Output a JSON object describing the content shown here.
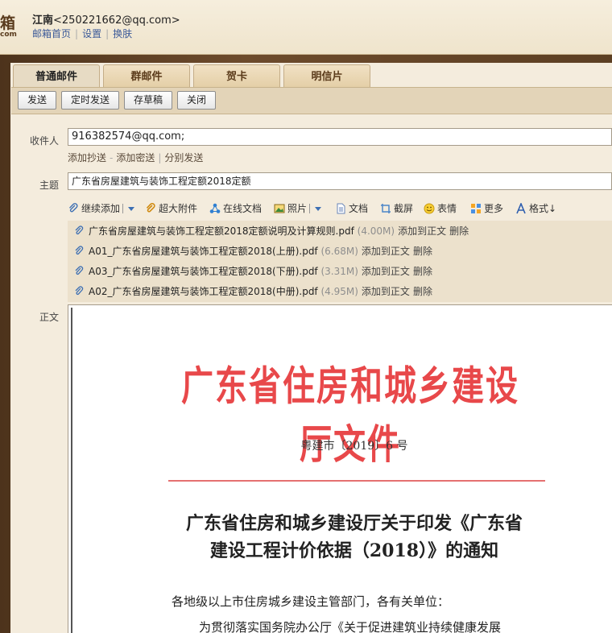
{
  "header": {
    "logo_char": "箱",
    "logo_sub": "com",
    "user_name": "江南",
    "user_email": "<250221662@qq.com>",
    "links": [
      "邮箱首页",
      "设置",
      "换肤"
    ]
  },
  "tabs": [
    "普通邮件",
    "群邮件",
    "贺卡",
    "明信片"
  ],
  "toolbar": {
    "send": "发送",
    "schedule": "定时发送",
    "draft": "存草稿",
    "close": "关闭"
  },
  "compose": {
    "to_label": "收件人",
    "to_value": "916382574@qq.com;",
    "sublinks": [
      "添加抄送",
      "添加密送",
      "分别发送"
    ],
    "subject_label": "主题",
    "subject_value": "广东省房屋建筑与装饰工程定额2018定额",
    "body_label": "正文"
  },
  "attach_tools": {
    "continue_add": "继续添加",
    "big_attach": "超大附件",
    "online_doc": "在线文档",
    "photo": "照片",
    "doc": "文档",
    "screenshot": "截屏",
    "emoji": "表情",
    "more": "更多",
    "format": "格式↓"
  },
  "attachments": [
    {
      "name": "广东省房屋建筑与装饰工程定额2018定额说明及计算规则.pdf",
      "size": "(4.00M)",
      "add": "添加到正文",
      "del": "删除"
    },
    {
      "name": "A01_广东省房屋建筑与装饰工程定额2018(上册).pdf",
      "size": "(6.68M)",
      "add": "添加到正文",
      "del": "删除"
    },
    {
      "name": "A03_广东省房屋建筑与装饰工程定额2018(下册).pdf",
      "size": "(3.31M)",
      "add": "添加到正文",
      "del": "删除"
    },
    {
      "name": "A02_广东省房屋建筑与装饰工程定额2018(中册).pdf",
      "size": "(4.95M)",
      "add": "添加到正文",
      "del": "删除"
    }
  ],
  "document": {
    "header": "广东省住房和城乡建设厅文件",
    "number": "粤建市〔2019〕6 号",
    "title_line1": "广东省住房和城乡建设厅关于印发《广东省",
    "title_line2": "建设工程计价依据（2018）》的通知",
    "para1": "各地级以上市住房城乡建设主管部门，各有关单位：",
    "para2": "为贯彻落实国务院办公厅《关于促进建筑业持续健康发展"
  },
  "colors": {
    "doc_red": "#e8484a",
    "panel_bg": "#f4ecdd",
    "wood": "#5a3d22"
  }
}
